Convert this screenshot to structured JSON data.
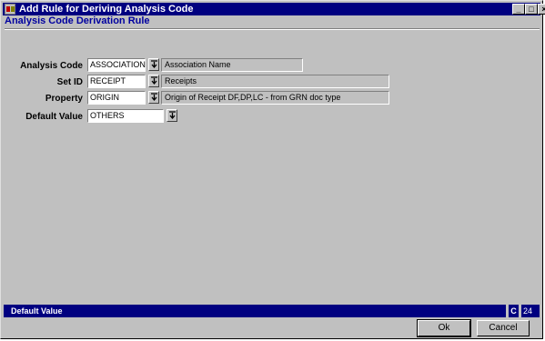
{
  "window": {
    "title": "Add Rule for Deriving Analysis Code",
    "controls": {
      "minimize": "_",
      "maximize": "□",
      "close": "×"
    }
  },
  "subtitle": "Analysis Code Derivation Rule",
  "form": {
    "rows": [
      {
        "label": "Analysis Code",
        "value": "ASSOCIATION",
        "description": "Association Name"
      },
      {
        "label": "Set ID",
        "value": "RECEIPT",
        "description": "Receipts"
      },
      {
        "label": "Property",
        "value": "ORIGIN",
        "description": "Origin of Receipt DF,DP,LC - from GRN doc type"
      },
      {
        "label": "Default Value",
        "value": "OTHERS",
        "description": ""
      }
    ]
  },
  "status": {
    "text": "Default Value",
    "mode": "C",
    "number": "24"
  },
  "buttons": {
    "ok": "Ok",
    "cancel": "Cancel"
  },
  "icons": {
    "app": "app-icon",
    "lookup": "lookup-arrow-icon"
  }
}
